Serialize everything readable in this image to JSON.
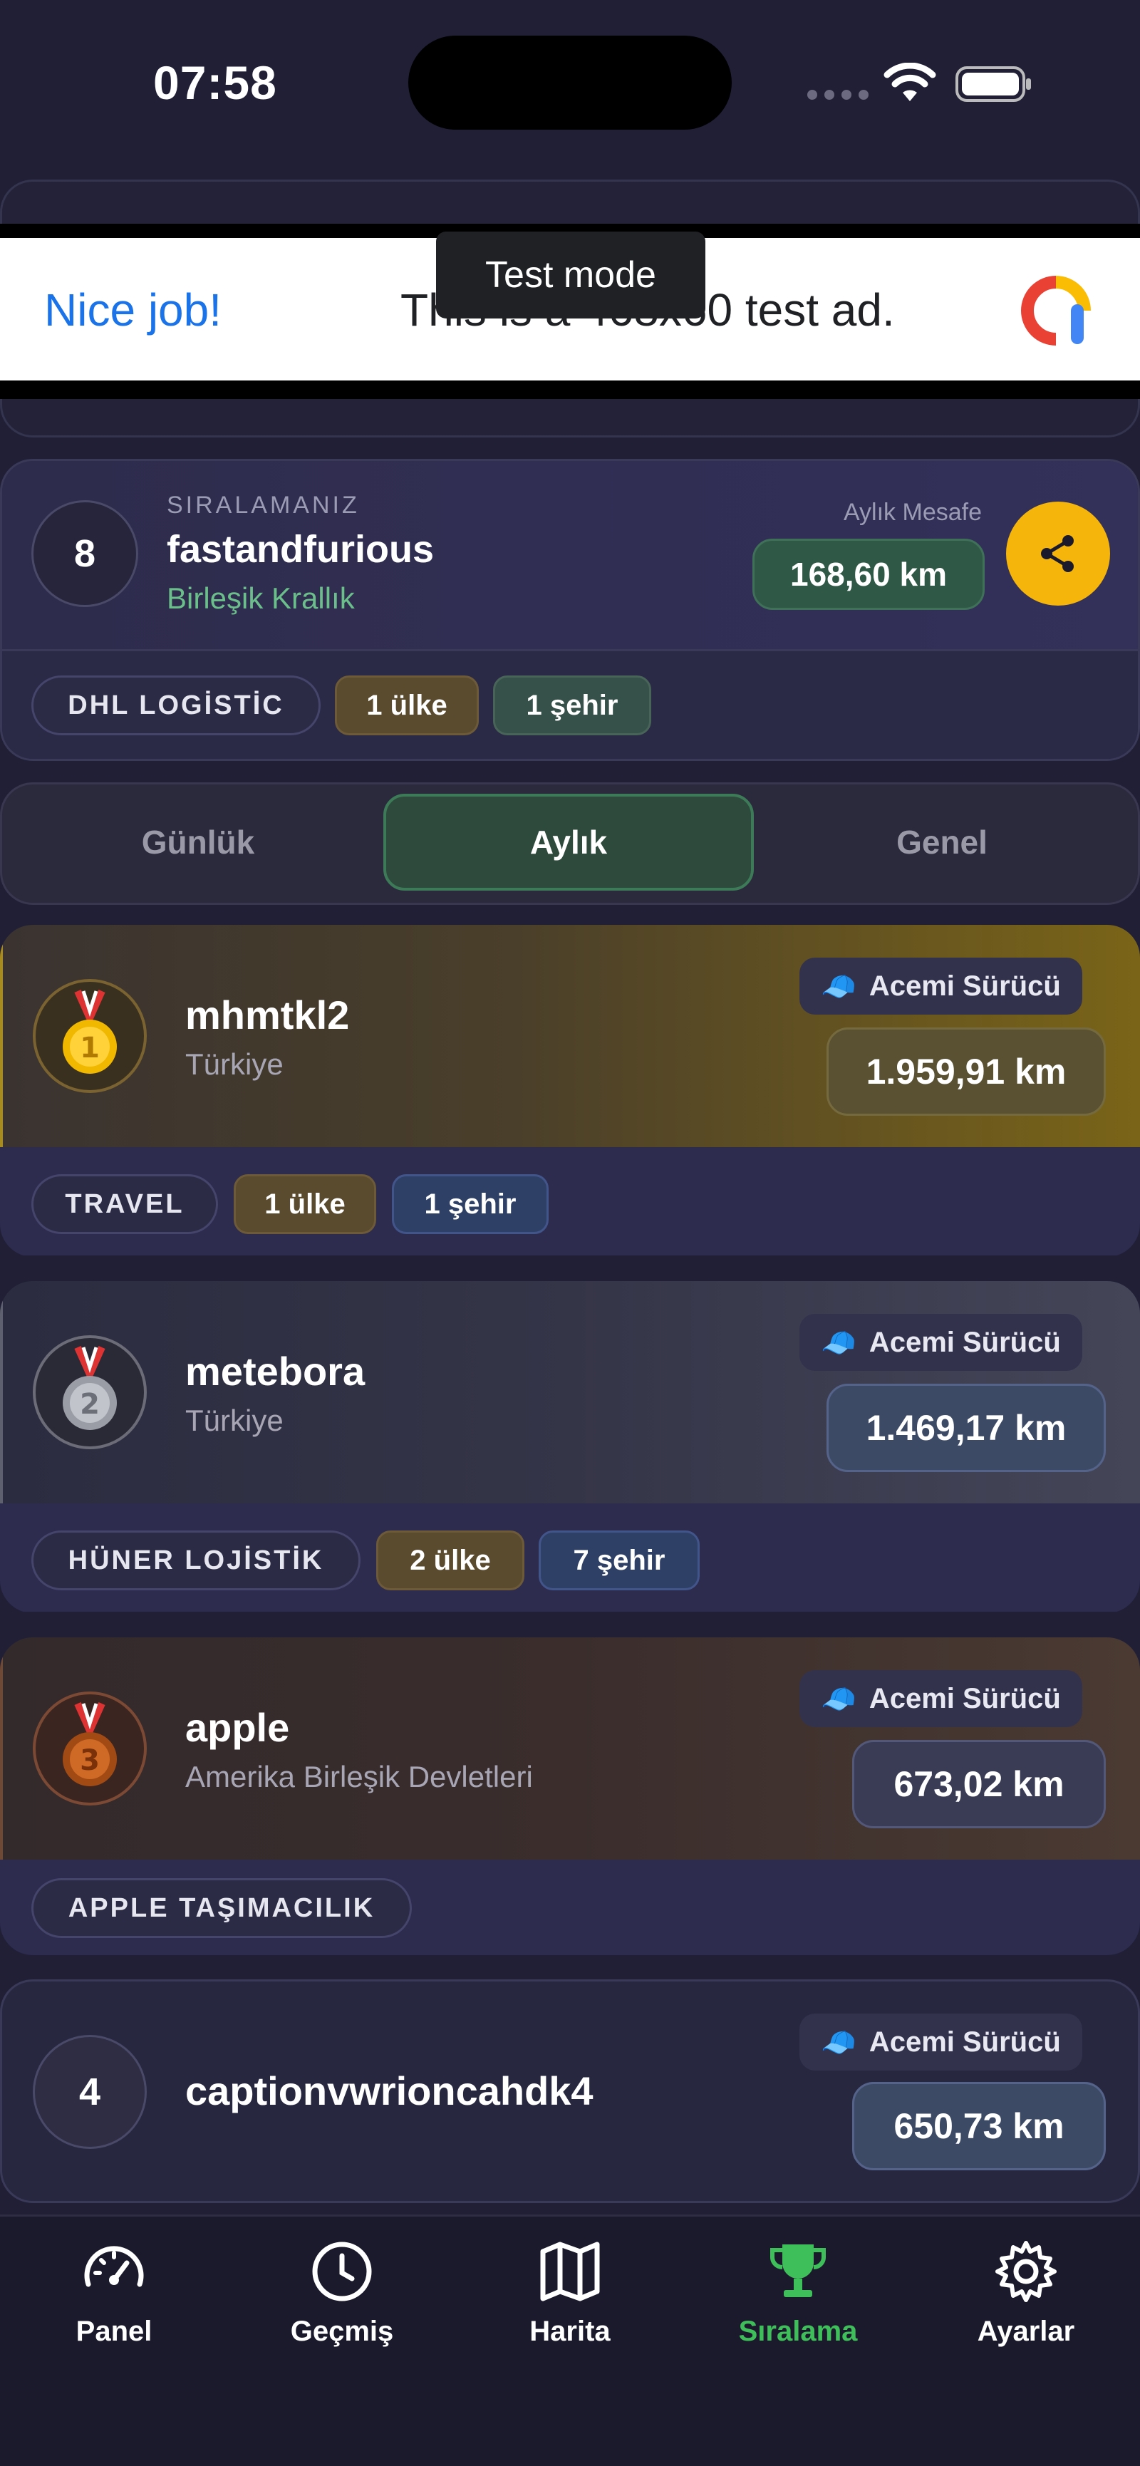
{
  "status": {
    "time": "07:58"
  },
  "ad": {
    "nice_text": "Nice job!",
    "body_text": "This is a 468x60 test ad.",
    "tooltip": "Test mode"
  },
  "me": {
    "rank": "8",
    "label": "SIRALAMANIZ",
    "name": "fastandfurious",
    "country": "Birleşik Krallık",
    "distance_label": "Aylık Mesafe",
    "distance": "168,60 km",
    "company": "DHL LOGİSTİC",
    "countries": "1 ülke",
    "cities": "1 şehir"
  },
  "tabs": [
    {
      "label": "Günlük"
    },
    {
      "label": "Aylık"
    },
    {
      "label": "Genel"
    }
  ],
  "leaders": [
    {
      "rank": "1",
      "name": "mhmtkl2",
      "country": "Türkiye",
      "badge": "Acemi Sürücü",
      "distance": "1.959,91 km",
      "company": "TRAVEL",
      "countries": "1 ülke",
      "cities": "1 şehir"
    },
    {
      "rank": "2",
      "name": "metebora",
      "country": "Türkiye",
      "badge": "Acemi Sürücü",
      "distance": "1.469,17 km",
      "company": "HÜNER LOJİSTİK",
      "countries": "2 ülke",
      "cities": "7 şehir"
    },
    {
      "rank": "3",
      "name": "apple",
      "country": "Amerika Birleşik Devletleri",
      "badge": "Acemi Sürücü",
      "distance": "673,02 km",
      "company": "APPLE TAŞIMACILIK"
    },
    {
      "rank": "4",
      "name": "captionvwrioncahdk4",
      "badge": "Acemi Sürücü",
      "distance": "650,73 km"
    }
  ],
  "nav": [
    {
      "label": "Panel",
      "icon": "speedometer-icon"
    },
    {
      "label": "Geçmiş",
      "icon": "clock-icon"
    },
    {
      "label": "Harita",
      "icon": "map-icon"
    },
    {
      "label": "Sıralama",
      "icon": "trophy-icon",
      "active": true
    },
    {
      "label": "Ayarlar",
      "icon": "gear-icon"
    }
  ],
  "colors": {
    "accent_green": "#3fbf5a",
    "share_yellow": "#f5b50a",
    "background": "#201f36"
  }
}
